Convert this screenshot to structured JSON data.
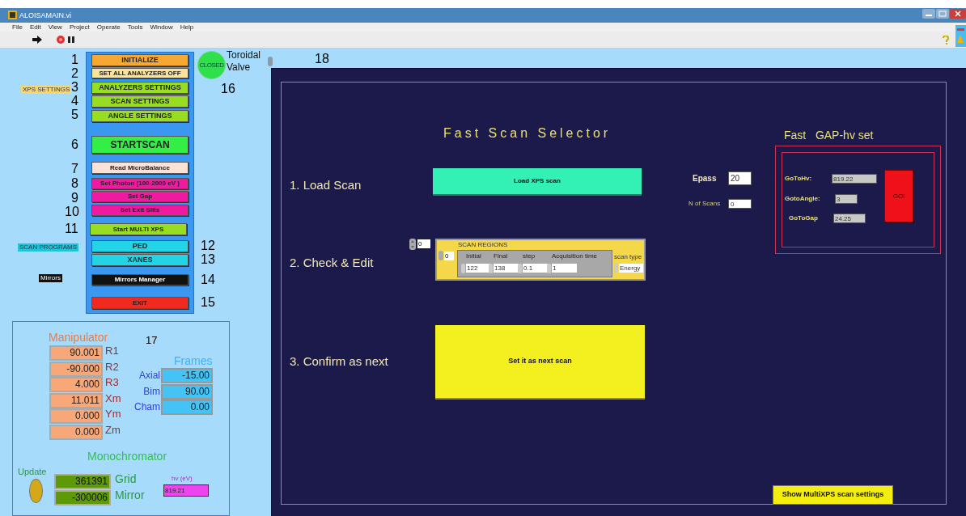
{
  "window": {
    "title": "ALOISAMAIN.vi"
  },
  "menu": [
    "File",
    "Edit",
    "View",
    "Project",
    "Operate",
    "Tools",
    "Window",
    "Help"
  ],
  "side_labels": [
    {
      "text": "XPS SETTINGS",
      "color": "#f5d76e"
    },
    {
      "text": "SCAN PROGRAMS",
      "color": "#22c4d8"
    },
    {
      "text": "Mirrors",
      "color": "#111111"
    }
  ],
  "buttons": [
    {
      "number": "1",
      "label": "INITIALIZE",
      "color": "#f7a833"
    },
    {
      "number": "2",
      "label": "SET ALL ANALYZERS OFF",
      "color": "#fbe39a"
    },
    {
      "number": "3",
      "label": "ANALYZERS SETTINGS",
      "color": "#99dd22"
    },
    {
      "number": "4",
      "label": "SCAN SETTINGS",
      "color": "#99dd22"
    },
    {
      "number": "5",
      "label": "ANGLE SETTINGS",
      "color": "#99dd22"
    },
    {
      "number": "6",
      "label": "STARTSCAN",
      "color": "#33ee44"
    },
    {
      "number": "7",
      "label": "Read MicroBalance",
      "color": "#fbe1d6"
    },
    {
      "number": "8",
      "label": "Set Photon (100-2000 eV )",
      "color": "#f01aa0"
    },
    {
      "number": "9",
      "label": "Set Gap",
      "color": "#f01aa0"
    },
    {
      "number": "10",
      "label": "Set Exit Slits",
      "color": "#f01aa0"
    },
    {
      "number": "11",
      "label": "Start MULTI XPS",
      "color": "#99dd22"
    },
    {
      "number": "12",
      "label": "PED",
      "color": "#22d4e6"
    },
    {
      "number": "13",
      "label": "XANES",
      "color": "#22d4e6"
    },
    {
      "number": "14",
      "label": "Mirrors Manager",
      "color": "#111111"
    },
    {
      "number": "15",
      "label": "EXIT",
      "color": "#f02a1e"
    }
  ],
  "valve": {
    "status": "CLOSED",
    "label": "Toroidal Valve",
    "number": "16"
  },
  "panel_number": "18",
  "fast_scan": {
    "title": "Fast Scan Selector",
    "steps": [
      "1. Load Scan",
      "2. Check & Edit",
      "3. Confirm as next"
    ],
    "load_button": "Load XPS scan",
    "epass": {
      "label": "Epass",
      "value": "20"
    },
    "n_scans": {
      "label": "N of Scans",
      "value": "0"
    },
    "array_index": "0",
    "scan_regions": {
      "title": "SCAN REGIONS",
      "index": "0",
      "columns": [
        "Initial",
        "Final",
        "step",
        "Acquisition time"
      ],
      "values": [
        "122",
        "138",
        "0.1",
        "1"
      ],
      "scan_type": {
        "label": "scan type",
        "value": "Energy"
      }
    },
    "confirm_button": "Set it as next scan"
  },
  "gap_hv": {
    "title": "Fast   GAP-hv set",
    "fields": [
      {
        "label": "GoToHv:",
        "value": "819.22"
      },
      {
        "label": "GotoAngle:",
        "value": "3"
      },
      {
        "label": "GoToGap",
        "value": "24.25"
      }
    ],
    "go_button": "GO!"
  },
  "show_button": "Show MultiXPS scan settings",
  "manipulator": {
    "title": "Manipulator",
    "number": "17",
    "rows": [
      {
        "value": "90.001",
        "label": "R1"
      },
      {
        "value": "-90.000",
        "label": "R2"
      },
      {
        "value": "4.000",
        "label": "R3"
      },
      {
        "value": "11.011",
        "label": "Xm"
      },
      {
        "value": "0.000",
        "label": "Ym"
      },
      {
        "value": "0.000",
        "label": "Zm"
      }
    ]
  },
  "frames": {
    "title": "Frames",
    "rows": [
      {
        "label": "Axial",
        "value": "-15.00"
      },
      {
        "label": "Bim",
        "value": "90.00"
      },
      {
        "label": "Cham",
        "value": "0.00"
      }
    ]
  },
  "monochromator": {
    "title": "Monochromator",
    "update": {
      "label": "Update",
      "on": false
    },
    "rows": [
      {
        "value": "361391",
        "label": "Grid"
      },
      {
        "value": "-300006",
        "label": "Mirror"
      }
    ],
    "hv": {
      "label": "hv (eV)",
      "value": "819.21"
    }
  }
}
